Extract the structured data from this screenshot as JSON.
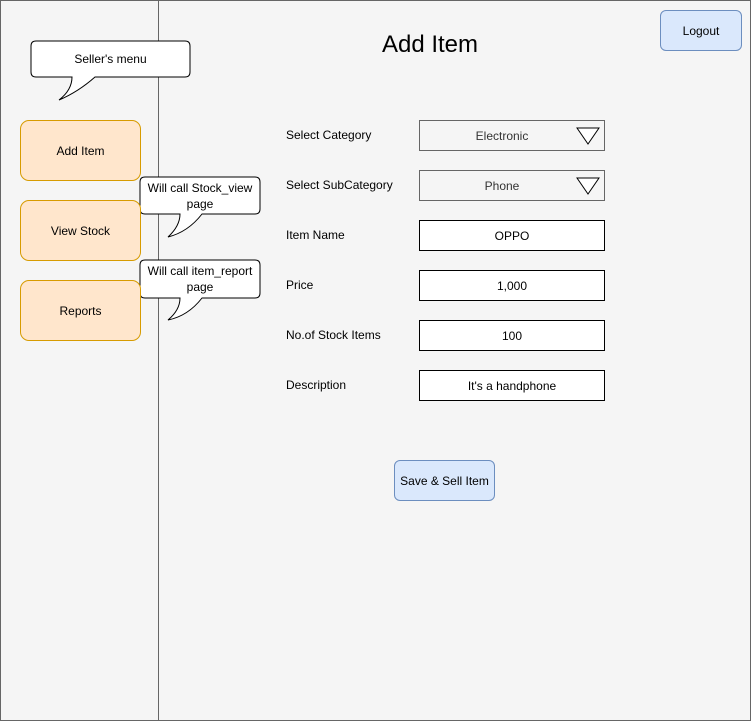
{
  "title": "Add Item",
  "logout_label": "Logout",
  "sidebar": {
    "callout": "Seller's menu",
    "items": [
      {
        "label": "Add Item"
      },
      {
        "label": "View Stock",
        "note": "Will call Stock_view page"
      },
      {
        "label": "Reports",
        "note": "Will call item_report page"
      }
    ]
  },
  "form": {
    "category": {
      "label": "Select Category",
      "value": "Electronic"
    },
    "subcategory": {
      "label": "Select SubCategory",
      "value": "Phone"
    },
    "item_name": {
      "label": "Item Name",
      "value": "OPPO"
    },
    "price": {
      "label": "Price",
      "value": "1,000"
    },
    "stock": {
      "label": "No.of Stock Items",
      "value": "100"
    },
    "description": {
      "label": "Description",
      "value": "It's a handphone"
    },
    "submit_label": "Save & Sell Item"
  },
  "colors": {
    "menu_fill": "#ffe6cc",
    "menu_border": "#d79b00",
    "button_fill": "#dae8fc",
    "button_border": "#6c8ebf"
  }
}
